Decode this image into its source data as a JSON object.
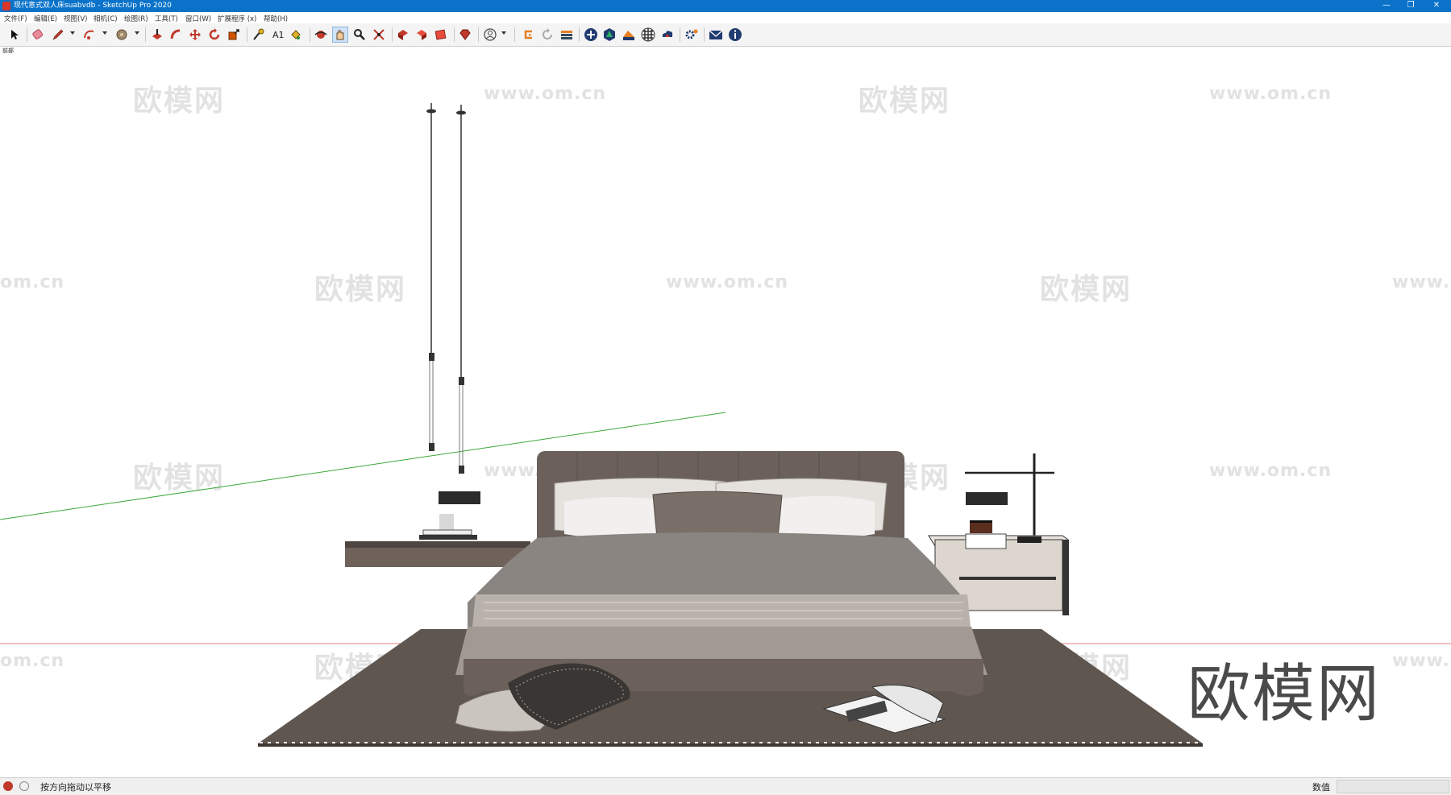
{
  "window": {
    "title": "现代意式双人床suabvdb - SketchUp Pro 2020",
    "minimize_glyph": "—",
    "restore_glyph": "❐",
    "close_glyph": "✕"
  },
  "menu": [
    "文件(F)",
    "编辑(E)",
    "视图(V)",
    "相机(C)",
    "绘图(R)",
    "工具(T)",
    "窗口(W)",
    "扩展程序 (x)",
    "帮助(H)"
  ],
  "toolbar": {
    "icons": [
      "select-icon",
      "eraser-icon",
      "pencil-icon",
      "arc-icon",
      "shape-icon",
      "push-pull-icon",
      "follow-me-icon",
      "move-icon",
      "rotate-icon",
      "scale-icon",
      "tape-measure-icon",
      "text-icon",
      "paint-bucket-icon",
      "orbit-icon",
      "pan-icon",
      "zoom-icon",
      "zoom-extents-icon",
      "3d-warehouse-icon",
      "extension-warehouse-icon",
      "layout-icon",
      "ruby-icon",
      "profile-icon",
      "sync-icon",
      "refresh-icon",
      "stack-icon",
      "add-location-icon",
      "tree-icon",
      "terrain-icon",
      "checker-icon",
      "cloud-icon",
      "settings-icon",
      "mail-icon",
      "info-icon"
    ],
    "active_tool": "pan-icon"
  },
  "viewport": {
    "scene_label": "前部"
  },
  "watermarks": {
    "brand": "欧模网",
    "url": "www.om.cn",
    "url_cut": "om.cn",
    "url_start": "www."
  },
  "status": {
    "hint": "按方向拖动以平移",
    "measurements_label": "数值",
    "measurements_value": ""
  },
  "colors": {
    "titlebar": "#0a73c9",
    "toolbar": "#f4f4f4",
    "statusbar": "#f0f0f0",
    "green_axis": "#3aa83a",
    "red_axis": "#e05050"
  }
}
